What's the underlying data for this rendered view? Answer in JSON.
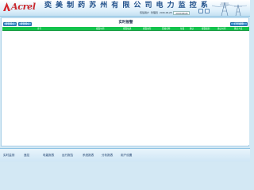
{
  "header": {
    "logo_text": "Acrel",
    "system_title": "奕 美 制 药 苏 州 有 限 公 司 电 力 监 控 系 统",
    "info_label": "值班用户",
    "info_value": "管理员",
    "datetime": "2016-06-28",
    "datetime_box": "2016/06/28"
  },
  "page": {
    "title": "实时报警",
    "left_buttons": [
      "报警确认",
      "报警确认"
    ],
    "right_button": "打印报警"
  },
  "table": {
    "columns": [
      "序号",
      "报警时间",
      "报警描述",
      "报警类型",
      "回路名称",
      "位置",
      "确认",
      "报警级别",
      "确认时间",
      "确认人员"
    ]
  },
  "nav": {
    "items": [
      "实时监测",
      "遥控",
      "电能报表",
      "运行报告",
      "系统报表",
      "分析报表",
      "用户设置"
    ]
  }
}
